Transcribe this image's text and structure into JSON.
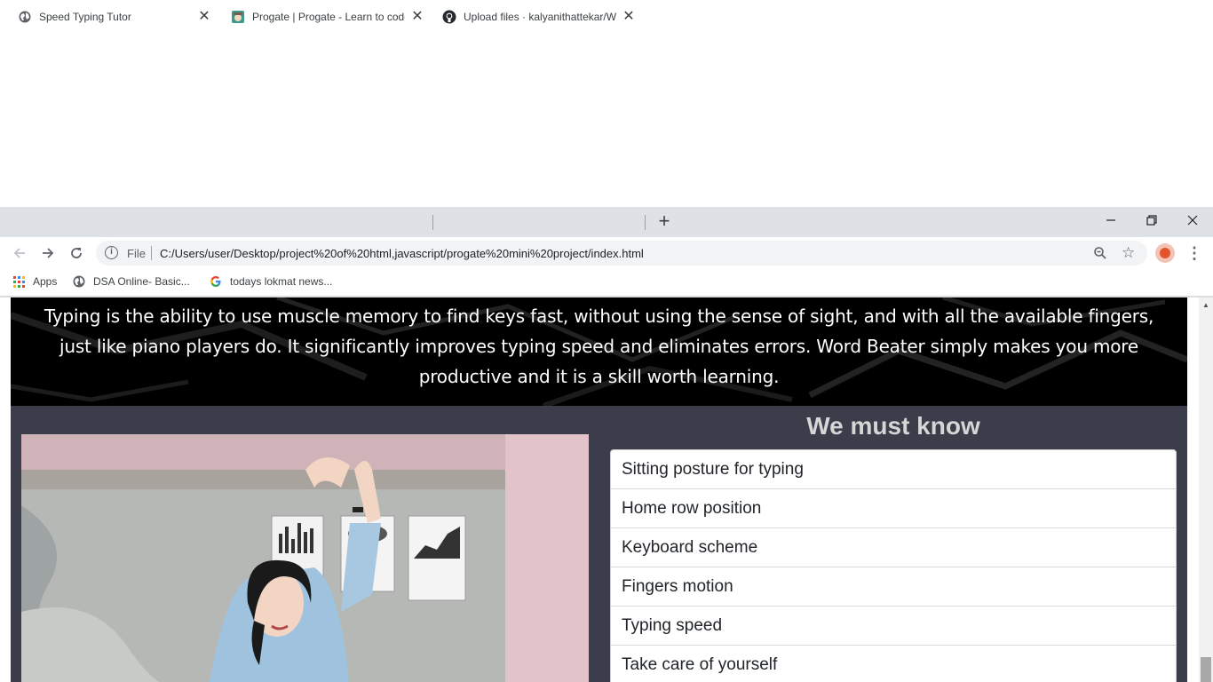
{
  "browser": {
    "tabs": [
      {
        "title": "Speed Typing Tutor",
        "icon": "globe-icon",
        "active": true
      },
      {
        "title": "Progate | Progate - Learn to code",
        "icon": "progate-icon",
        "active": false
      },
      {
        "title": "Upload files · kalyanithattekar/W",
        "icon": "github-icon",
        "active": false
      }
    ],
    "address": {
      "scheme_label": "File",
      "url": "C:/Users/user/Desktop/project%20of%20html,javascript/progate%20mini%20project/index.html"
    },
    "bookmarks": [
      {
        "label": "Apps",
        "icon": "apps-grid-icon"
      },
      {
        "label": "DSA Online- Basic...",
        "icon": "globe-icon"
      },
      {
        "label": "todays lokmat news...",
        "icon": "google-icon"
      }
    ]
  },
  "page": {
    "hero_text": "Typing is the ability to use muscle memory to find keys fast, without using the sense of sight, and with all the available fingers, just like piano players do. It significantly improves typing speed and eliminates errors. Word Beater simply makes you more productive and it is a skill worth learning.",
    "section_title": "We must know",
    "topics": [
      "Sitting posture for typing",
      "Home row position",
      "Keyboard scheme",
      "Fingers motion",
      "Typing speed",
      "Take care of yourself"
    ]
  },
  "colors": {
    "tabstrip_bg": "#dee1e6",
    "hero_bg": "#000000",
    "content_bg": "#3b3d4a",
    "section_title": "#d6d6d6"
  }
}
